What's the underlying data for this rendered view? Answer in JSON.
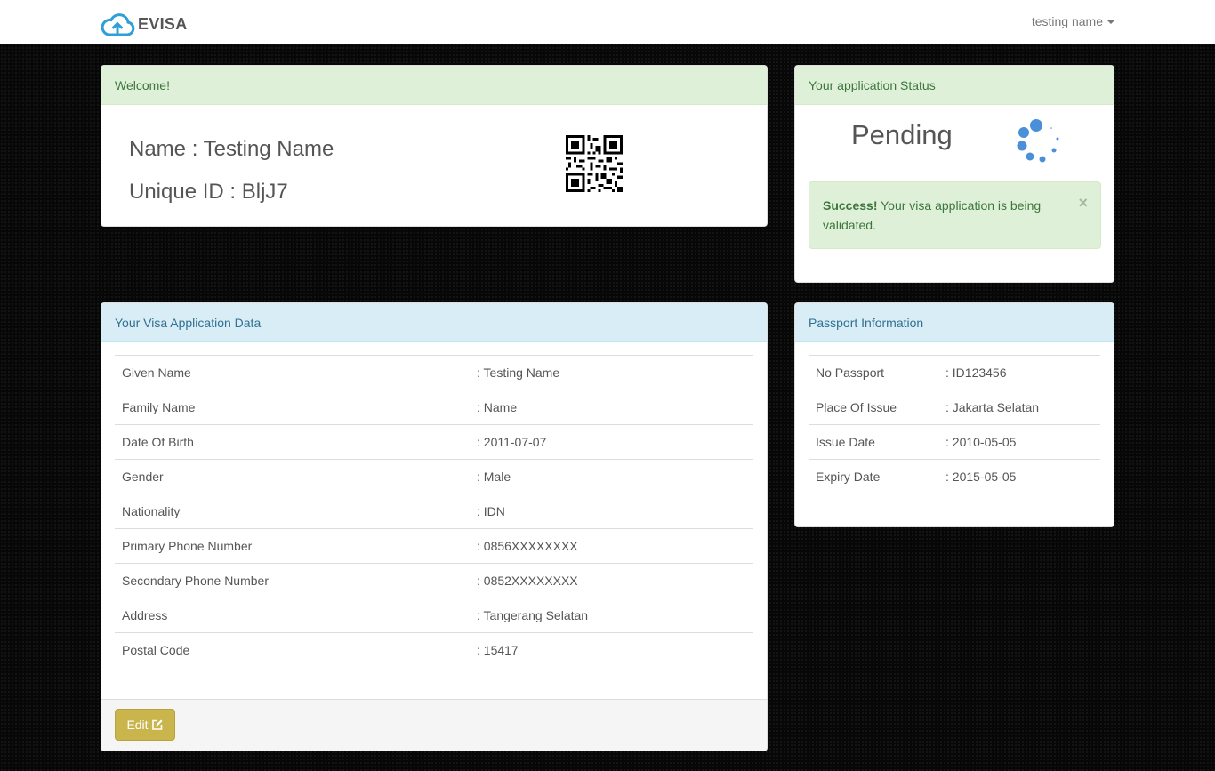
{
  "brand": {
    "name": "EVISA",
    "logo_icon": "cloud-upload-icon"
  },
  "user_menu": {
    "label": "testing name"
  },
  "welcome": {
    "heading": "Welcome!",
    "name_line": "Name : Testing Name",
    "id_line": "Unique ID : BljJ7"
  },
  "status": {
    "heading": "Your application Status",
    "value": "Pending",
    "alert_strong": "Success!",
    "alert_text": " Your visa application is being validated.",
    "close": "×"
  },
  "visa": {
    "heading": "Your Visa Application Data",
    "rows": [
      {
        "label": "Given Name",
        "value": ": Testing Name"
      },
      {
        "label": "Family Name",
        "value": ": Name"
      },
      {
        "label": "Date Of Birth",
        "value": ": 2011-07-07"
      },
      {
        "label": "Gender",
        "value": ": Male"
      },
      {
        "label": "Nationality",
        "value": ": IDN"
      },
      {
        "label": "Primary Phone Number",
        "value": ": 0856XXXXXXXX"
      },
      {
        "label": "Secondary Phone Number",
        "value": ": 0852XXXXXXXX"
      },
      {
        "label": "Address",
        "value": ": Tangerang Selatan"
      },
      {
        "label": "Postal Code",
        "value": ": 15417"
      }
    ],
    "edit_label": "Edit"
  },
  "passport": {
    "heading": "Passport Information",
    "rows": [
      {
        "label": "No Passport",
        "value": ": ID123456"
      },
      {
        "label": "Place Of Issue",
        "value": ": Jakarta Selatan"
      },
      {
        "label": "Issue Date",
        "value": ": 2010-05-05"
      },
      {
        "label": "Expiry Date",
        "value": ": 2015-05-05"
      }
    ]
  },
  "colors": {
    "success_bg": "#dff0d8",
    "info_bg": "#d9edf7",
    "edit_button": "#c9b54c",
    "spinner": "#4a90d9"
  }
}
